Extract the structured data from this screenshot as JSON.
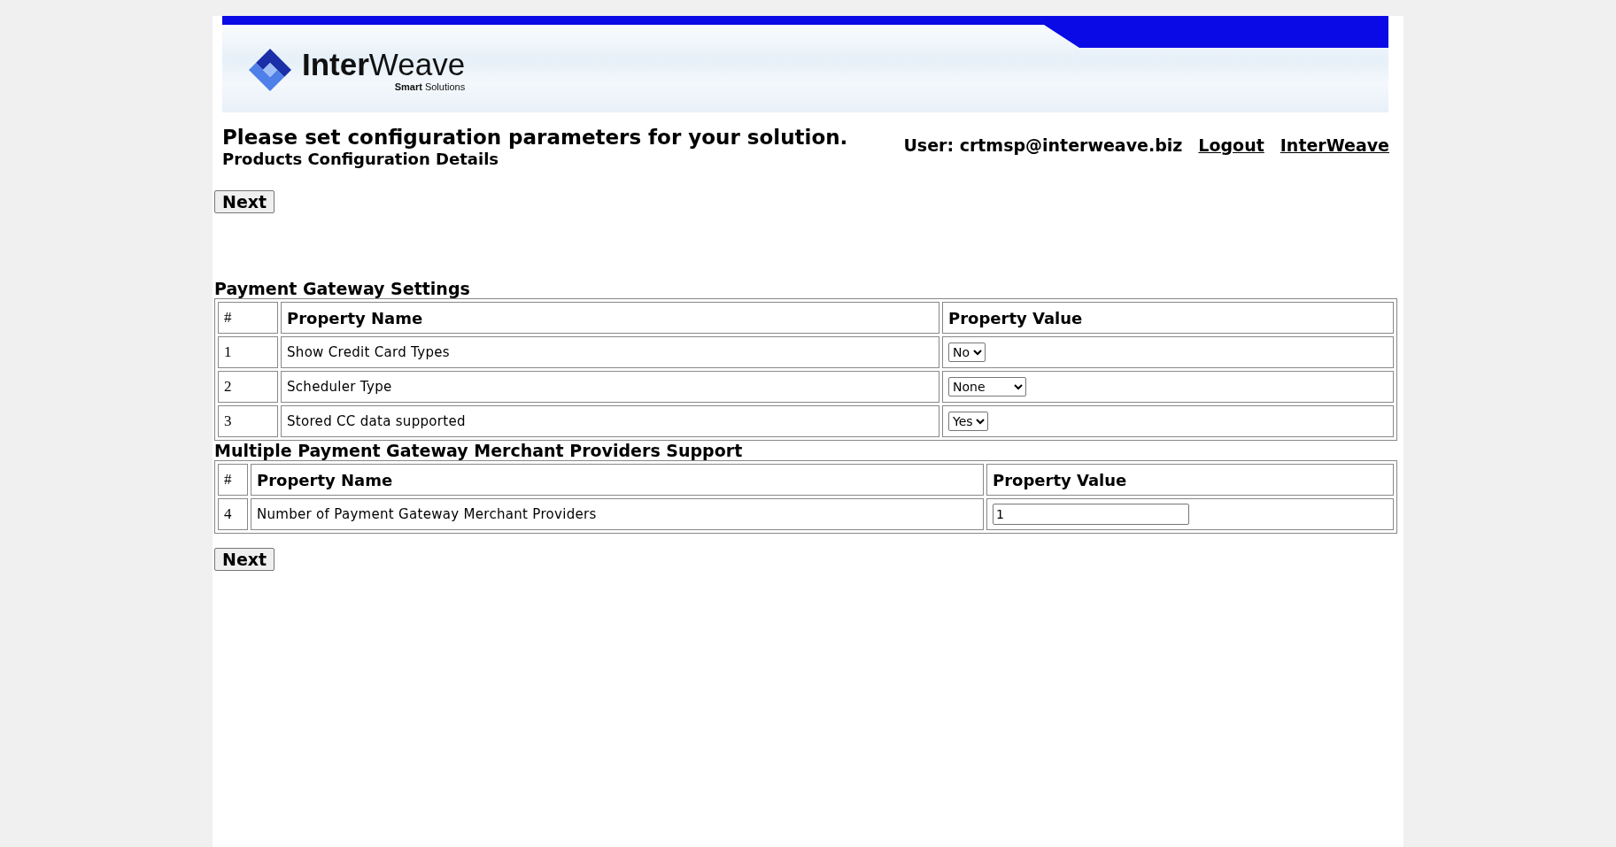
{
  "banner": {
    "logo": "**Inter**Weave",
    "tagline": "**Smart** Solutions"
  },
  "heading": {
    "title": "Please set configuration parameters for your solution.",
    "subtitle": "Products Configuration Details"
  },
  "user": {
    "label": "User: crtmsp@interweave.biz",
    "links": [
      "Logout",
      "InterWeave"
    ]
  },
  "top_button": "Next",
  "sections": [
    {
      "title": "Payment Gateway Settings",
      "columns": [
        "#",
        "Property Name",
        "Property Value"
      ],
      "rows": [
        {
          "number": "1",
          "name": "Show Credit Card Types",
          "kind": "select",
          "value": "No"
        },
        {
          "number": "2",
          "name": "Scheduler Type",
          "kind": "select",
          "value": "None"
        },
        {
          "number": "3",
          "name": "Stored CC data supported",
          "kind": "select",
          "value": "Yes"
        }
      ]
    },
    {
      "title": "Multiple Payment Gateway Merchant Providers Support",
      "columns": [
        "#",
        "Property Name",
        "Property Value"
      ],
      "rows": [
        {
          "number": "4",
          "name": "Number of Payment Gateway Merchant Providers",
          "kind": "text",
          "value": "1"
        }
      ]
    }
  ],
  "bottom_button": "Next"
}
